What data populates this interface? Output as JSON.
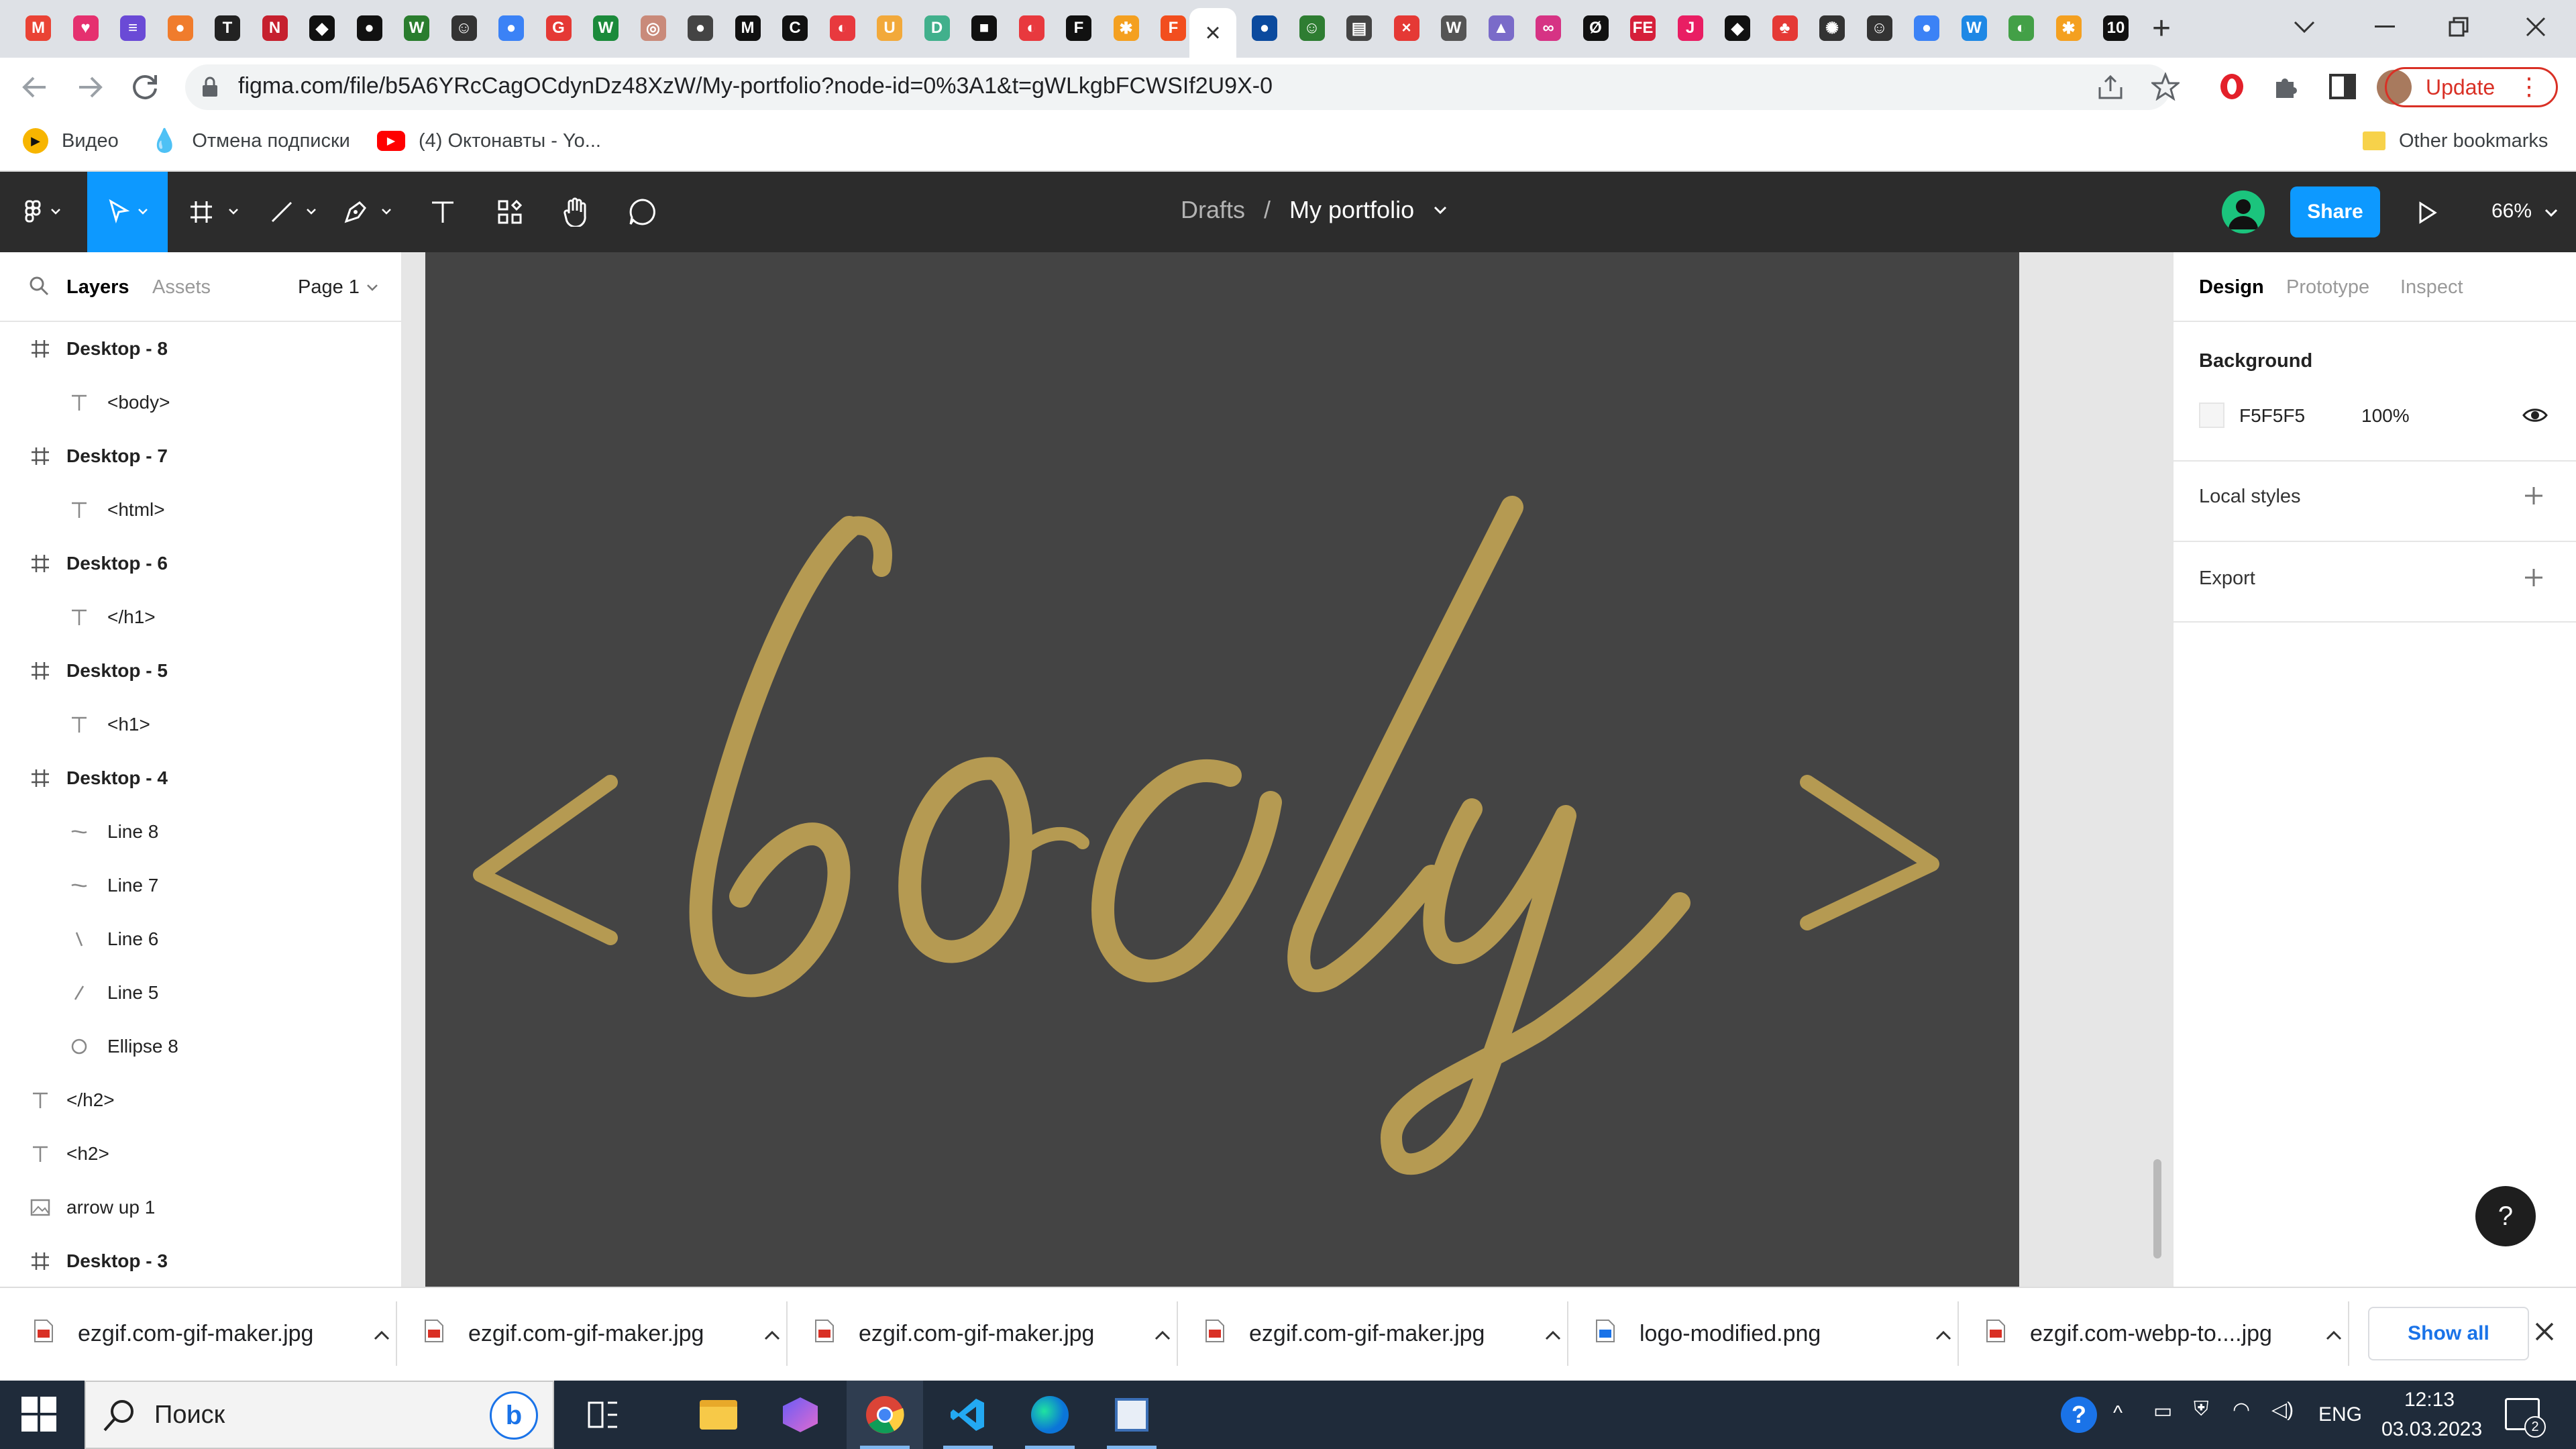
{
  "browser": {
    "url": "figma.com/file/b5A6YRcCagOCdynDz48XzW/My-portfolio?node-id=0%3A1&t=gWLkgbFCWSIf2U9X-0",
    "update_label": "Update",
    "tab_close": "×",
    "new_tab": "+",
    "tab_favicons": [
      {
        "name": "gmail",
        "color": "#ea4335",
        "glyph": "M"
      },
      {
        "name": "heart",
        "color": "#e5306f",
        "glyph": "♥"
      },
      {
        "name": "app",
        "color": "#6a4ad6",
        "glyph": "≡"
      },
      {
        "name": "app",
        "color": "#f07c2c",
        "glyph": "●"
      },
      {
        "name": "app",
        "color": "#222222",
        "glyph": "T"
      },
      {
        "name": "app",
        "color": "#c6202e",
        "glyph": "N"
      },
      {
        "name": "codepen",
        "color": "#111111",
        "glyph": "◆"
      },
      {
        "name": "github",
        "color": "#111111",
        "glyph": "●"
      },
      {
        "name": "app",
        "color": "#2a7d2e",
        "glyph": "W"
      },
      {
        "name": "app",
        "color": "#333333",
        "glyph": "☺"
      },
      {
        "name": "app",
        "color": "#3b82f6",
        "glyph": "●"
      },
      {
        "name": "app",
        "color": "#e53935",
        "glyph": "G"
      },
      {
        "name": "app",
        "color": "#1b8a3b",
        "glyph": "W"
      },
      {
        "name": "app",
        "color": "#c98a7a",
        "glyph": "◎"
      },
      {
        "name": "app",
        "color": "#444444",
        "glyph": "●"
      },
      {
        "name": "app",
        "color": "#111111",
        "glyph": "M"
      },
      {
        "name": "app",
        "color": "#111111",
        "glyph": "C"
      },
      {
        "name": "app",
        "color": "#e8393e",
        "glyph": "◐"
      },
      {
        "name": "app",
        "color": "#f2a93b",
        "glyph": "U"
      },
      {
        "name": "app",
        "color": "#41b08c",
        "glyph": "D"
      },
      {
        "name": "app",
        "color": "#111111",
        "glyph": "■"
      },
      {
        "name": "app",
        "color": "#e8393e",
        "glyph": "◐"
      },
      {
        "name": "app",
        "color": "#111111",
        "glyph": "F"
      },
      {
        "name": "app",
        "color": "#f4a020",
        "glyph": "✱"
      },
      {
        "name": "figma",
        "color": "#f24e1e",
        "glyph": "F"
      }
    ],
    "tab_favicons_right": [
      {
        "name": "app",
        "color": "#0b4a9e",
        "glyph": "●"
      },
      {
        "name": "app",
        "color": "#2e7d32",
        "glyph": "☺"
      },
      {
        "name": "app",
        "color": "#444444",
        "glyph": "▤"
      },
      {
        "name": "app",
        "color": "#e53935",
        "glyph": "×"
      },
      {
        "name": "wordpress",
        "color": "#555555",
        "glyph": "W"
      },
      {
        "name": "app",
        "color": "#7a6bc9",
        "glyph": "▲"
      },
      {
        "name": "app",
        "color": "#d63384",
        "glyph": "∞"
      },
      {
        "name": "app",
        "color": "#111111",
        "glyph": "Ø"
      },
      {
        "name": "app",
        "color": "#d61f3a",
        "glyph": "FE"
      },
      {
        "name": "app",
        "color": "#e91e63",
        "glyph": "J"
      },
      {
        "name": "codepen",
        "color": "#111111",
        "glyph": "◆"
      },
      {
        "name": "app",
        "color": "#e53935",
        "glyph": "♣"
      },
      {
        "name": "app",
        "color": "#333333",
        "glyph": "✺"
      },
      {
        "name": "app",
        "color": "#333333",
        "glyph": "☺"
      },
      {
        "name": "app",
        "color": "#3b82f6",
        "glyph": "●"
      },
      {
        "name": "app",
        "color": "#1e88e5",
        "glyph": "W"
      },
      {
        "name": "app",
        "color": "#43a047",
        "glyph": "◐"
      },
      {
        "name": "app",
        "color": "#f4a020",
        "glyph": "✱"
      },
      {
        "name": "app",
        "color": "#111111",
        "glyph": "10"
      }
    ],
    "bookmarks": [
      {
        "label": "Видео",
        "icon": "play-icon"
      },
      {
        "label": "Отмена подписки",
        "icon": "drop-icon"
      },
      {
        "label": "(4) Октонавты - Yo...",
        "icon": "youtube-icon"
      }
    ],
    "other_bookmarks": "Other bookmarks"
  },
  "figma": {
    "breadcrumb_parent": "Drafts",
    "breadcrumb_sep": "/",
    "file_name": "My portfolio",
    "share_label": "Share",
    "zoom": "66%",
    "panel_tabs": [
      "Layers",
      "Assets"
    ],
    "page_selector": "Page 1",
    "layers": [
      {
        "label": "Desktop - 8",
        "type": "frame",
        "indent": 0
      },
      {
        "label": "<body>",
        "type": "text",
        "indent": 1
      },
      {
        "label": "Desktop - 7",
        "type": "frame",
        "indent": 0
      },
      {
        "label": "<html>",
        "type": "text",
        "indent": 1
      },
      {
        "label": "Desktop - 6",
        "type": "frame",
        "indent": 0
      },
      {
        "label": "</h1>",
        "type": "text",
        "indent": 1
      },
      {
        "label": "Desktop - 5",
        "type": "frame",
        "indent": 0
      },
      {
        "label": "<h1>",
        "type": "text",
        "indent": 1
      },
      {
        "label": "Desktop - 4",
        "type": "frame",
        "indent": 0
      },
      {
        "label": "Line 8",
        "type": "line-tilde",
        "indent": 1
      },
      {
        "label": "Line 7",
        "type": "line-tilde",
        "indent": 1
      },
      {
        "label": "Line 6",
        "type": "line-back",
        "indent": 1
      },
      {
        "label": "Line 5",
        "type": "line-fwd",
        "indent": 1
      },
      {
        "label": "Ellipse 8",
        "type": "ellipse",
        "indent": 1
      },
      {
        "label": "</h2>",
        "type": "text",
        "indent": 0
      },
      {
        "label": "<h2>",
        "type": "text",
        "indent": 0
      },
      {
        "label": "arrow up 1",
        "type": "image",
        "indent": 0
      },
      {
        "label": "Desktop - 3",
        "type": "frame",
        "indent": 0
      }
    ],
    "canvas_text": "<body>",
    "canvas_text_color": "#b59a52",
    "canvas_bg": "#444444",
    "design_tabs": [
      "Design",
      "Prototype",
      "Inspect"
    ],
    "background_label": "Background",
    "background_hex": "F5F5F5",
    "background_opacity": "100%",
    "local_styles": "Local styles",
    "export": "Export",
    "help": "?"
  },
  "downloads": {
    "items": [
      "ezgif.com-gif-maker.jpg",
      "ezgif.com-gif-maker.jpg",
      "ezgif.com-gif-maker.jpg",
      "ezgif.com-gif-maker.jpg",
      "logo-modified.png",
      "ezgif.com-webp-to....jpg"
    ],
    "show_all": "Show all"
  },
  "taskbar": {
    "search_placeholder": "Поиск",
    "lang": "ENG",
    "time": "12:13",
    "date": "03.03.2023",
    "notifications": "2"
  }
}
